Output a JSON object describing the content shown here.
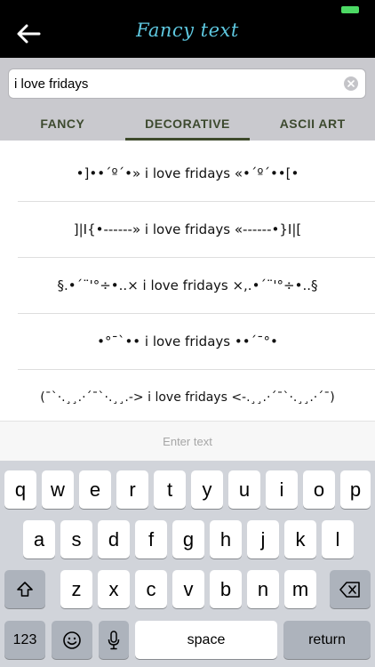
{
  "header": {
    "title": "Fancy text"
  },
  "search": {
    "value": "i love fridays"
  },
  "tabs": [
    {
      "label": "FANCY",
      "active": false
    },
    {
      "label": "DECORATIVE",
      "active": true
    },
    {
      "label": "ASCII ART",
      "active": false
    }
  ],
  "results": [
    "•]••´º´•» i love fridays «•´º´••[•",
    "]|I{•------» i love fridays «------•}I|[",
    "§.•´¨'°÷•..× i love fridays ×,.•´¨'°÷•..§",
    "•°¯`•• i love fridays ••´¯°•",
    "(¯`·.¸¸.·´¯`·.¸¸.-> i love fridays <-.¸¸.·´¯`·.¸¸.·´¯)"
  ],
  "input_hint": "Enter text",
  "keyboard": {
    "row1": [
      "q",
      "w",
      "e",
      "r",
      "t",
      "y",
      "u",
      "i",
      "o",
      "p"
    ],
    "row2": [
      "a",
      "s",
      "d",
      "f",
      "g",
      "h",
      "j",
      "k",
      "l"
    ],
    "row3": [
      "z",
      "x",
      "c",
      "v",
      "b",
      "n",
      "m"
    ],
    "numbers_label": "123",
    "space_label": "space",
    "return_label": "return"
  },
  "colors": {
    "header_bg": "#000000",
    "title": "#5ec8e0",
    "tab_text": "#3d4a2f",
    "status_battery": "#4cd964"
  }
}
